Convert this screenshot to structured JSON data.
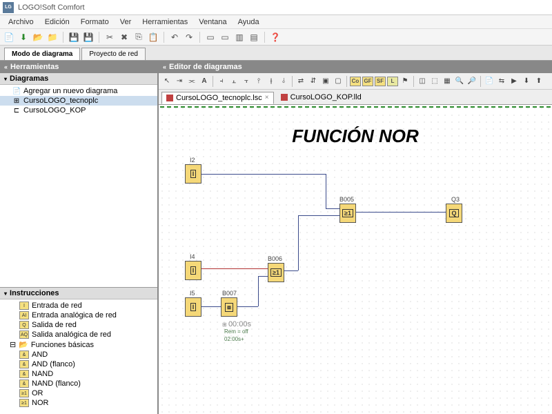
{
  "app": {
    "title": "LOGO!Soft Comfort"
  },
  "menu": [
    "Archivo",
    "Edición",
    "Formato",
    "Ver",
    "Herramientas",
    "Ventana",
    "Ayuda"
  ],
  "modeTabs": [
    {
      "label": "Modo de diagrama",
      "active": true
    },
    {
      "label": "Proyecto de red",
      "active": false
    }
  ],
  "panels": {
    "tools": "Herramientas",
    "diagrams": "Diagramas",
    "instructions": "Instrucciones",
    "editor": "Editor de diagramas"
  },
  "diagramTree": {
    "addNew": "Agregar un nuevo diagrama",
    "items": [
      {
        "label": "CursoLOGO_tecnoplc",
        "selected": true,
        "icon": "⊞"
      },
      {
        "label": "CursoLOGO_KOP",
        "selected": false,
        "icon": "⊏"
      }
    ]
  },
  "instructions": {
    "net": [
      {
        "label": "Entrada de red",
        "sym": "I"
      },
      {
        "label": "Entrada analógica de red",
        "sym": "AI"
      },
      {
        "label": "Salida de red",
        "sym": "Q"
      },
      {
        "label": "Salida analógica de red",
        "sym": "AQ"
      }
    ],
    "basicFolder": "Funciones básicas",
    "basic": [
      {
        "label": "AND",
        "sym": "&"
      },
      {
        "label": "AND (flanco)",
        "sym": "&"
      },
      {
        "label": "NAND",
        "sym": "&"
      },
      {
        "label": "NAND (flanco)",
        "sym": "&"
      },
      {
        "label": "OR",
        "sym": "≥1"
      },
      {
        "label": "NOR",
        "sym": "≥1"
      }
    ]
  },
  "fileTabs": [
    {
      "label": "CursoLOGO_tecnoplc.lsc",
      "active": true
    },
    {
      "label": "CursoLOGO_KOP.lld",
      "active": false
    }
  ],
  "canvas": {
    "title": "FUNCIÓN NOR",
    "blocks": {
      "i2": {
        "label": "I2",
        "sym": "I"
      },
      "i4": {
        "label": "I4",
        "sym": "I"
      },
      "i5": {
        "label": "I5",
        "sym": "I"
      },
      "b005": {
        "label": "B005",
        "sym": "≥1"
      },
      "b006": {
        "label": "B006",
        "sym": "≥1"
      },
      "b007": {
        "label": "B007",
        "sym": "⧈"
      },
      "q3": {
        "label": "Q3",
        "sym": "Q"
      }
    },
    "annotations": {
      "time": "00:00s",
      "rem": "Rem = off",
      "extra": "02:00s+"
    }
  },
  "editorBoxLabels": [
    "Co",
    "GF",
    "SF",
    "L"
  ]
}
